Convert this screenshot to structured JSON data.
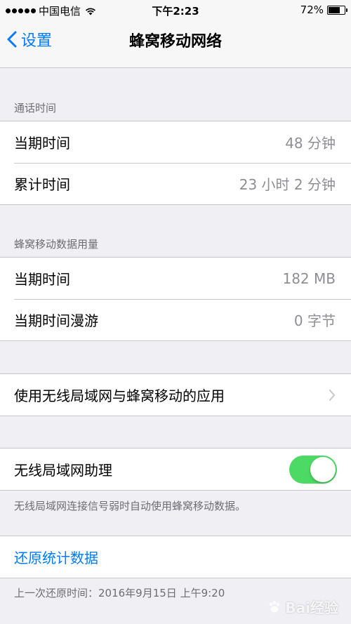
{
  "status_bar": {
    "carrier": "中国电信",
    "time": "下午2:23",
    "battery": "72%",
    "battery_level": 0.72
  },
  "nav": {
    "back_label": "设置",
    "title": "蜂窝移动网络"
  },
  "call_time": {
    "header": "通话时间",
    "rows": [
      {
        "label": "当期时间",
        "value": "48 分钟"
      },
      {
        "label": "累计时间",
        "value": "23 小时 2 分钟"
      }
    ]
  },
  "cellular_data": {
    "header": "蜂窝移动数据用量",
    "rows": [
      {
        "label": "当期时间",
        "value": "182 MB"
      },
      {
        "label": "当期时间漫游",
        "value": "0 字节"
      }
    ]
  },
  "apps_row": {
    "label": "使用无线局域网与蜂窝移动的应用"
  },
  "wifi_assist": {
    "label": "无线局域网助理",
    "enabled": true,
    "note": "无线局域网连接信号弱时自动使用蜂窝移动数据。"
  },
  "reset": {
    "label": "还原统计数据",
    "last_reset": "上一次还原时间：2016年9月15日 上午9:20"
  },
  "watermark": "Bai经验",
  "colors": {
    "accent": "#007aff",
    "toggle_on": "#4cd964",
    "background": "#efeff4"
  }
}
